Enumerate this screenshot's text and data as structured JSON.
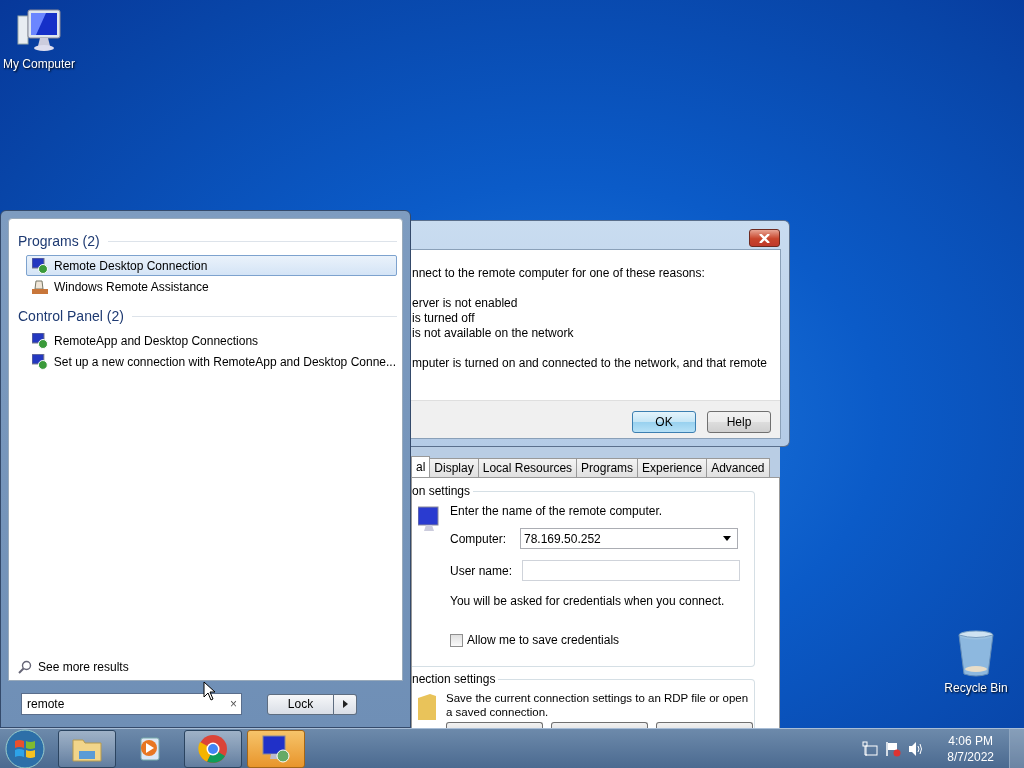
{
  "desktop_icons": [
    {
      "kind": "computer",
      "label": "My Computer"
    },
    {
      "kind": "recycle",
      "label": "Recycle Bin"
    }
  ],
  "error_dialog": {
    "intro": "nnect to the remote computer for one of these reasons:",
    "reasons": [
      "erver is not enabled",
      "is turned off",
      "is not available on the network"
    ],
    "advice": "mputer is turned on and connected to the network, and that remote",
    "buttons": [
      {
        "label": "OK",
        "selected": true
      },
      {
        "label": "Help",
        "selected": false
      }
    ]
  },
  "rdc_window": {
    "tabs": [
      {
        "label": "al",
        "selected": true
      },
      {
        "label": "Display",
        "selected": false
      },
      {
        "label": "Local Resources",
        "selected": false
      },
      {
        "label": "Programs",
        "selected": false
      },
      {
        "label": "Experience",
        "selected": false
      },
      {
        "label": "Advanced",
        "selected": false
      }
    ],
    "logon": {
      "title": "on settings",
      "intro": "Enter the name of the remote computer.",
      "computer_label": "Computer:",
      "computer_value": "78.169.50.252",
      "user_label": "User name:",
      "note": "You will be asked for credentials when you connect.",
      "save_credentials": {
        "label": "Allow me to save credentials",
        "checked": false
      }
    },
    "connection": {
      "title": "nection settings",
      "text": "Save the current connection settings to an RDP file or open a saved connection."
    }
  },
  "start_menu": {
    "groups": [
      {
        "title": "Programs (2)",
        "items": [
          {
            "label": "Remote Desktop Connection",
            "kind": "rdc",
            "selected": true
          },
          {
            "label": "Windows Remote Assistance",
            "kind": "assist",
            "selected": false
          }
        ]
      },
      {
        "title": "Control Panel (2)",
        "items": [
          {
            "label": "RemoteApp and Desktop Connections",
            "kind": "rdc",
            "selected": false
          },
          {
            "label": "Set up a new connection with RemoteApp and Desktop Conne...",
            "kind": "rdc",
            "selected": false
          }
        ]
      }
    ],
    "see_more": "See more results",
    "search": {
      "value": "remote",
      "clear": "×"
    },
    "power_button": "Lock"
  },
  "taskbar": {
    "items": [
      {
        "kind": "explorer",
        "running": true,
        "highlighted": false
      },
      {
        "kind": "media",
        "running": false,
        "highlighted": false
      },
      {
        "kind": "chrome",
        "running": true,
        "highlighted": false
      },
      {
        "kind": "rdc",
        "running": true,
        "highlighted": true
      }
    ],
    "clock": {
      "time": "4:06 PM",
      "date": "8/7/2022"
    }
  }
}
